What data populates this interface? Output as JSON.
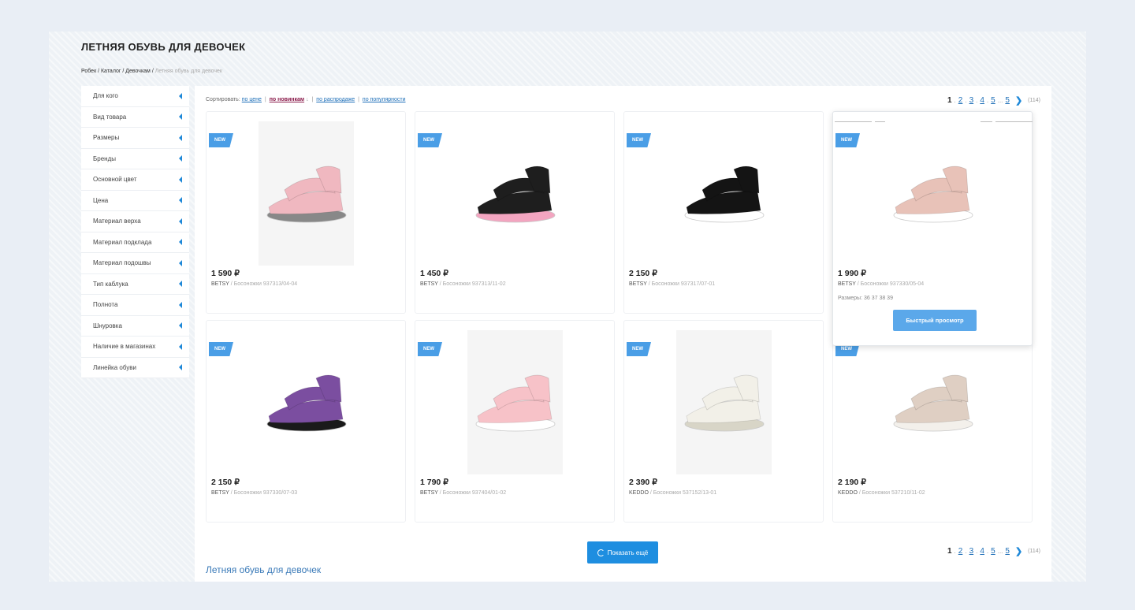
{
  "page": {
    "title": "ЛЕТНЯЯ ОБУВЬ ДЛЯ ДЕВОЧЕК",
    "breadcrumb": [
      "Робек",
      "Каталог",
      "Девочкам",
      "Летняя обувь для девочек"
    ]
  },
  "sidebar": {
    "items": [
      "Для кого",
      "Вид товара",
      "Размеры",
      "Бренды",
      "Основной цвет",
      "Цена",
      "Материал верха",
      "Материал подклада",
      "Материал подошвы",
      "Тип каблука",
      "Полнота",
      "Шнуровка",
      "Наличие в магазинах",
      "Линейка обуви"
    ]
  },
  "sort": {
    "label": "Сортировать:",
    "options": [
      "по цене",
      "по новинкам",
      "по распродаже",
      "по популярности"
    ],
    "active_index": 1,
    "active_arrow": "↓"
  },
  "pagination": {
    "pages": [
      "1",
      "2",
      "3",
      "4",
      "5",
      "5"
    ],
    "ellipsis": "...",
    "current": "1",
    "total": "(114)",
    "next_icon": "chevron-right-icon"
  },
  "products": [
    {
      "badge": "NEW",
      "price": "1 590 ₽",
      "brand": "BETSY",
      "name": " / Босоножки 937313/04-04",
      "color": "#f0b8c0",
      "accent": "#888888"
    },
    {
      "badge": "NEW",
      "price": "1 450 ₽",
      "brand": "BETSY",
      "name": " / Босоножки 937313/11-02",
      "color": "#1e1e1e",
      "accent": "#f3a5c0"
    },
    {
      "badge": "NEW",
      "price": "2 150 ₽",
      "brand": "BETSY",
      "name": " / Босоножки 937317/07-01",
      "color": "#141414",
      "accent": "#ffffff"
    },
    {
      "badge": "NEW",
      "price": "1 990 ₽",
      "brand": "BETSY",
      "name": " / Босоножки 937330/05-04",
      "color": "#e8c2b8",
      "accent": "#ffffff",
      "sizes": "Размеры: 36 37 38 39",
      "quick_view": "Быстрый просмотр"
    },
    {
      "badge": "NEW",
      "price": "2 150 ₽",
      "brand": "BETSY",
      "name": " / Босоножки 937330/07-03",
      "color": "#7b4ea0",
      "accent": "#1a1a1a"
    },
    {
      "badge": "NEW",
      "price": "1 790 ₽",
      "brand": "BETSY",
      "name": " / Босоножки 937404/01-02",
      "color": "#f7c2c8",
      "accent": "#ffffff"
    },
    {
      "badge": "NEW",
      "price": "2 390 ₽",
      "brand": "KEDDO",
      "name": " / Босоножки 537152/13-01",
      "color": "#f2f0e8",
      "accent": "#d8d5c7"
    },
    {
      "badge": "NEW",
      "price": "2 190 ₽",
      "brand": "KEDDO",
      "name": " / Босоножки 537210/11-02",
      "color": "#dfcfc3",
      "accent": "#f3f0eb"
    }
  ],
  "show_more": "Показать ещё",
  "bottom_title": "Летняя обувь для девочек"
}
